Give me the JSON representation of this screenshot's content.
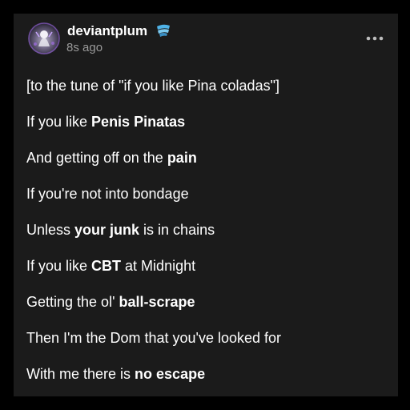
{
  "post": {
    "username": "deviantplum",
    "timestamp": "8s ago",
    "lines": [
      {
        "parts": [
          {
            "text": "[to the tune of \"if you like Pina coladas\"]",
            "bold": false
          }
        ]
      },
      {
        "parts": [
          {
            "text": "If you like ",
            "bold": false
          },
          {
            "text": "Penis Pinatas",
            "bold": true
          }
        ]
      },
      {
        "parts": [
          {
            "text": "And getting off on the ",
            "bold": false
          },
          {
            "text": "pain",
            "bold": true
          }
        ]
      },
      {
        "parts": [
          {
            "text": "If you're not into bondage",
            "bold": false
          }
        ]
      },
      {
        "parts": [
          {
            "text": "Unless ",
            "bold": false
          },
          {
            "text": "your junk",
            "bold": true
          },
          {
            "text": " is in chains",
            "bold": false
          }
        ]
      },
      {
        "parts": [
          {
            "text": "If you like ",
            "bold": false
          },
          {
            "text": "CBT",
            "bold": true
          },
          {
            "text": " at Midnight",
            "bold": false
          }
        ]
      },
      {
        "parts": [
          {
            "text": "Getting the ol' ",
            "bold": false
          },
          {
            "text": "ball-scrape",
            "bold": true
          }
        ]
      },
      {
        "parts": [
          {
            "text": "Then I'm the Dom that you've looked for",
            "bold": false
          }
        ]
      },
      {
        "parts": [
          {
            "text": "With me there is ",
            "bold": false
          },
          {
            "text": "no escape",
            "bold": true
          }
        ]
      }
    ]
  },
  "icons": {
    "avatar": "avatar-image",
    "badge": "badge-icon",
    "more": "more-options-icon"
  },
  "colors": {
    "page_background": "#000000",
    "card_background": "#1b1b1b",
    "text_primary": "#ffffff",
    "text_secondary": "#9a9a9a",
    "badge_accent": "#4fb3e8"
  }
}
